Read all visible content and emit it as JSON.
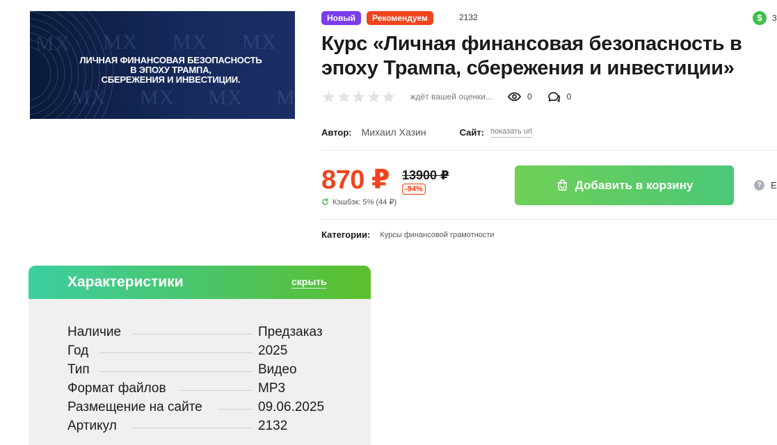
{
  "banner": {
    "lines": [
      "ЛИЧНАЯ ФИНАНСОВАЯ БЕЗОПАСНОСТЬ",
      "В ЭПОХУ ТРАМПА,",
      "СБЕРЕЖЕНИЯ И ИНВЕСТИЦИИ."
    ],
    "watermark": "MX"
  },
  "badges": {
    "new": "Новый",
    "recommended": "Рекомендуем"
  },
  "article_top": "2132",
  "cashback_top": {
    "icon": "dollar-icon",
    "value": "3"
  },
  "title": "Курс «Личная финансовая безопасность в эпоху Трампа, сбережения и инвестиции»",
  "rating": {
    "stars": 0,
    "max": 5,
    "text": "ждёт вашей оценки...",
    "views": "0",
    "comments": "0"
  },
  "author": {
    "label": "Автор:",
    "name": "Михаил Хазин"
  },
  "site": {
    "label": "Сайт:",
    "link": "показать url"
  },
  "price": {
    "current": "870 ₽",
    "old": "13900 ₽",
    "discount": "-94%",
    "cashback": "Кэшбэк: 5% (44 ₽)"
  },
  "cart_button": "Добавить в корзину",
  "help_text": "Е",
  "categories": {
    "label": "Категории:",
    "value": "Курсы финансовой грамотности"
  },
  "characteristics": {
    "title": "Характеристики",
    "hide": "скрыть",
    "rows": [
      {
        "label": "Наличие",
        "value": "Предзаказ"
      },
      {
        "label": "Год",
        "value": "2025"
      },
      {
        "label": "Тип",
        "value": "Видео"
      },
      {
        "label": "Формат файлов",
        "value": "MP3"
      },
      {
        "label": "Размещение на сайте",
        "value": "09.06.2025"
      },
      {
        "label": "Артикул",
        "value": "2132"
      }
    ]
  },
  "colors": {
    "accent_red": "#f0441e",
    "purple": "#7a3de8",
    "green": "#4bc877"
  }
}
